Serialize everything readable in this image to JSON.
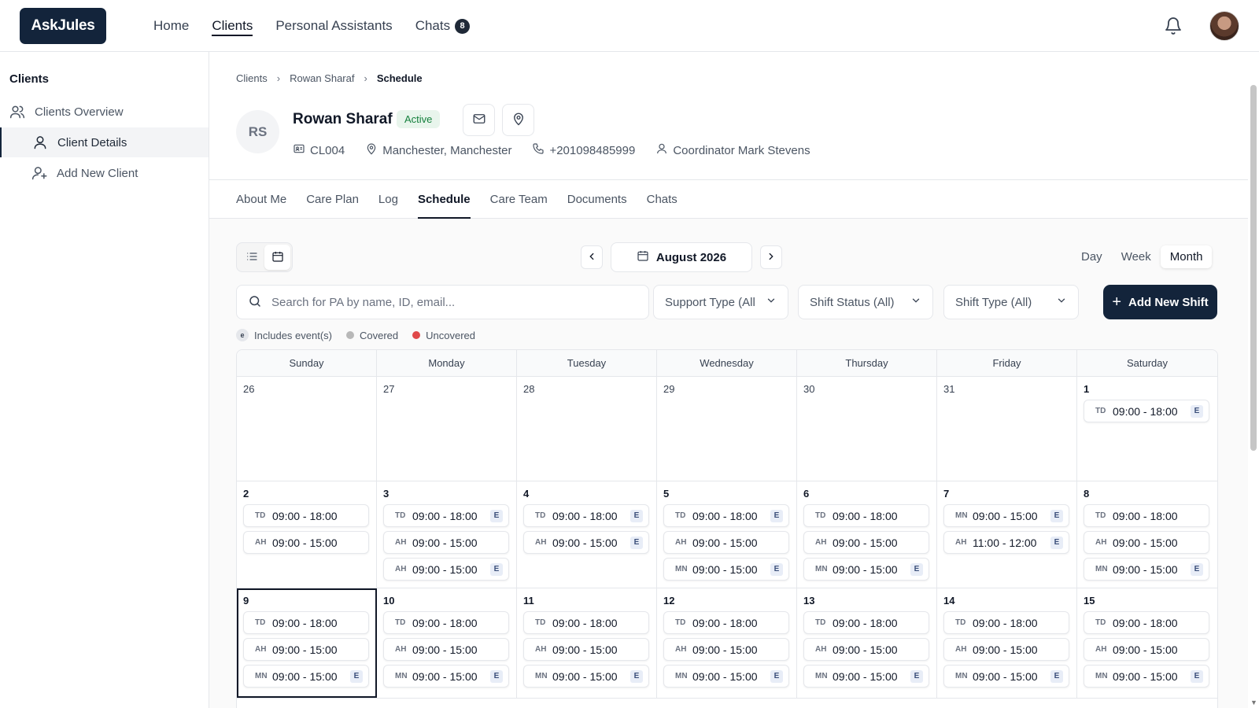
{
  "app": {
    "logo": "AskJules",
    "nav": [
      {
        "label": "Home",
        "active": false
      },
      {
        "label": "Clients",
        "active": true
      },
      {
        "label": "Personal Assistants",
        "active": false
      },
      {
        "label": "Chats",
        "active": false,
        "count": "8"
      }
    ]
  },
  "sidebar": {
    "title": "Clients",
    "items": [
      {
        "label": "Clients Overview",
        "icon": "users-icon",
        "active": false
      },
      {
        "label": "Client Details",
        "icon": "user-icon",
        "active": true
      },
      {
        "label": "Add New Client",
        "icon": "user-plus-icon",
        "active": false
      }
    ]
  },
  "breadcrumb": [
    "Clients",
    "Rowan Sharaf",
    "Schedule"
  ],
  "client": {
    "initials": "RS",
    "name": "Rowan Sharaf",
    "status": "Active",
    "id": "CL004",
    "location": "Manchester, Manchester",
    "phone": "+201098485999",
    "coordinator": "Coordinator Mark Stevens"
  },
  "tabs": [
    "About Me",
    "Care Plan",
    "Log",
    "Schedule",
    "Care Team",
    "Documents",
    "Chats"
  ],
  "active_tab": "Schedule",
  "schedule": {
    "month_label": "August 2026",
    "ranges": [
      "Day",
      "Week",
      "Month"
    ],
    "active_range": "Month",
    "search_placeholder": "Search for PA by name, ID, email...",
    "filters": [
      "Support Type (All",
      "Shift Status (All)",
      "Shift Type (All)"
    ],
    "add_button": "Add New Shift",
    "legend": {
      "events_badge": "e",
      "events_label": "Includes event(s)",
      "covered_label": "Covered",
      "uncovered_label": "Uncovered",
      "covered_color": "#b8b8b8",
      "uncovered_color": "#e0494a"
    },
    "weekdays": [
      "Sunday",
      "Monday",
      "Tuesday",
      "Wednesday",
      "Thursday",
      "Friday",
      "Saturday"
    ],
    "event_badge": "E",
    "weeks": [
      [
        {
          "day": "26",
          "shifts": []
        },
        {
          "day": "27",
          "shifts": []
        },
        {
          "day": "28",
          "shifts": []
        },
        {
          "day": "29",
          "shifts": []
        },
        {
          "day": "30",
          "shifts": []
        },
        {
          "day": "31",
          "shifts": []
        },
        {
          "day": "1",
          "current": true,
          "shifts": [
            {
              "code": "TD",
              "time": "09:00 - 18:00",
              "event": true
            }
          ]
        }
      ],
      [
        {
          "day": "2",
          "current": true,
          "shifts": [
            {
              "code": "TD",
              "time": "09:00 - 18:00",
              "event": false
            },
            {
              "code": "AH",
              "time": "09:00 - 15:00",
              "event": false
            }
          ]
        },
        {
          "day": "3",
          "current": true,
          "shifts": [
            {
              "code": "TD",
              "time": "09:00 - 18:00",
              "event": true
            },
            {
              "code": "AH",
              "time": "09:00 - 15:00",
              "event": false
            },
            {
              "code": "AH",
              "time": "09:00 - 15:00",
              "event": true
            }
          ]
        },
        {
          "day": "4",
          "current": true,
          "shifts": [
            {
              "code": "TD",
              "time": "09:00 - 18:00",
              "event": true
            },
            {
              "code": "AH",
              "time": "09:00 - 15:00",
              "event": true
            }
          ]
        },
        {
          "day": "5",
          "current": true,
          "shifts": [
            {
              "code": "TD",
              "time": "09:00 - 18:00",
              "event": true
            },
            {
              "code": "AH",
              "time": "09:00 - 15:00",
              "event": false
            },
            {
              "code": "MN",
              "time": "09:00 - 15:00",
              "event": true
            }
          ]
        },
        {
          "day": "6",
          "current": true,
          "shifts": [
            {
              "code": "TD",
              "time": "09:00 - 18:00",
              "event": false
            },
            {
              "code": "AH",
              "time": "09:00 - 15:00",
              "event": false
            },
            {
              "code": "MN",
              "time": "09:00 - 15:00",
              "event": true
            }
          ]
        },
        {
          "day": "7",
          "current": true,
          "shifts": [
            {
              "code": "MN",
              "time": "09:00 - 15:00",
              "event": true
            },
            {
              "code": "AH",
              "time": "11:00 - 12:00",
              "event": true
            }
          ]
        },
        {
          "day": "8",
          "current": true,
          "shifts": [
            {
              "code": "TD",
              "time": "09:00 - 18:00",
              "event": false
            },
            {
              "code": "AH",
              "time": "09:00 - 15:00",
              "event": false
            },
            {
              "code": "MN",
              "time": "09:00 - 15:00",
              "event": true
            }
          ]
        }
      ],
      [
        {
          "day": "9",
          "current": true,
          "selected": true,
          "shifts": [
            {
              "code": "TD",
              "time": "09:00 - 18:00",
              "event": false
            },
            {
              "code": "AH",
              "time": "09:00 - 15:00",
              "event": false
            },
            {
              "code": "MN",
              "time": "09:00 - 15:00",
              "event": true
            }
          ]
        },
        {
          "day": "10",
          "current": true,
          "shifts": [
            {
              "code": "TD",
              "time": "09:00 - 18:00",
              "event": false
            },
            {
              "code": "AH",
              "time": "09:00 - 15:00",
              "event": false
            },
            {
              "code": "MN",
              "time": "09:00 - 15:00",
              "event": true
            }
          ]
        },
        {
          "day": "11",
          "current": true,
          "shifts": [
            {
              "code": "TD",
              "time": "09:00 - 18:00",
              "event": false
            },
            {
              "code": "AH",
              "time": "09:00 - 15:00",
              "event": false
            },
            {
              "code": "MN",
              "time": "09:00 - 15:00",
              "event": true
            }
          ]
        },
        {
          "day": "12",
          "current": true,
          "shifts": [
            {
              "code": "TD",
              "time": "09:00 - 18:00",
              "event": false
            },
            {
              "code": "AH",
              "time": "09:00 - 15:00",
              "event": false
            },
            {
              "code": "MN",
              "time": "09:00 - 15:00",
              "event": true
            }
          ]
        },
        {
          "day": "13",
          "current": true,
          "shifts": [
            {
              "code": "TD",
              "time": "09:00 - 18:00",
              "event": false
            },
            {
              "code": "AH",
              "time": "09:00 - 15:00",
              "event": false
            },
            {
              "code": "MN",
              "time": "09:00 - 15:00",
              "event": true
            }
          ]
        },
        {
          "day": "14",
          "current": true,
          "shifts": [
            {
              "code": "TD",
              "time": "09:00 - 18:00",
              "event": false
            },
            {
              "code": "AH",
              "time": "09:00 - 15:00",
              "event": false
            },
            {
              "code": "MN",
              "time": "09:00 - 15:00",
              "event": true
            }
          ]
        },
        {
          "day": "15",
          "current": true,
          "shifts": [
            {
              "code": "TD",
              "time": "09:00 - 18:00",
              "event": false
            },
            {
              "code": "AH",
              "time": "09:00 - 15:00",
              "event": false
            },
            {
              "code": "MN",
              "time": "09:00 - 15:00",
              "event": true
            }
          ]
        }
      ]
    ]
  }
}
